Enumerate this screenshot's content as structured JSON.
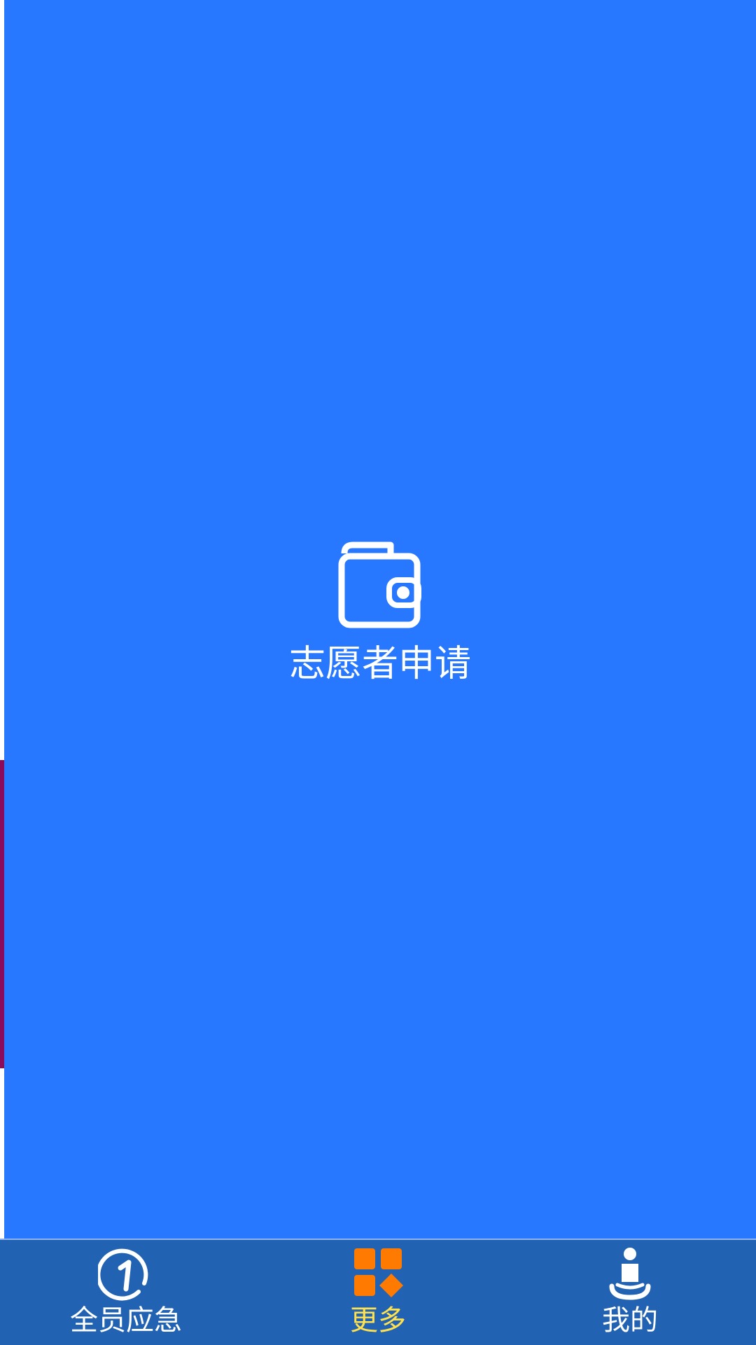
{
  "main": {
    "action": {
      "label": "志愿者申请",
      "icon": "wallet-icon"
    }
  },
  "bottom_nav": {
    "items": [
      {
        "label": "全员应急",
        "icon": "emergency-one-icon",
        "active": false
      },
      {
        "label": "更多",
        "icon": "more-grid-icon",
        "active": true
      },
      {
        "label": "我的",
        "icon": "person-icon",
        "active": false
      }
    ]
  },
  "colors": {
    "background": "#2878FF",
    "nav_background": "#2262B2",
    "active_label": "#FFE14D",
    "active_icon": "#FF7A00",
    "text": "#FFFFFF"
  }
}
